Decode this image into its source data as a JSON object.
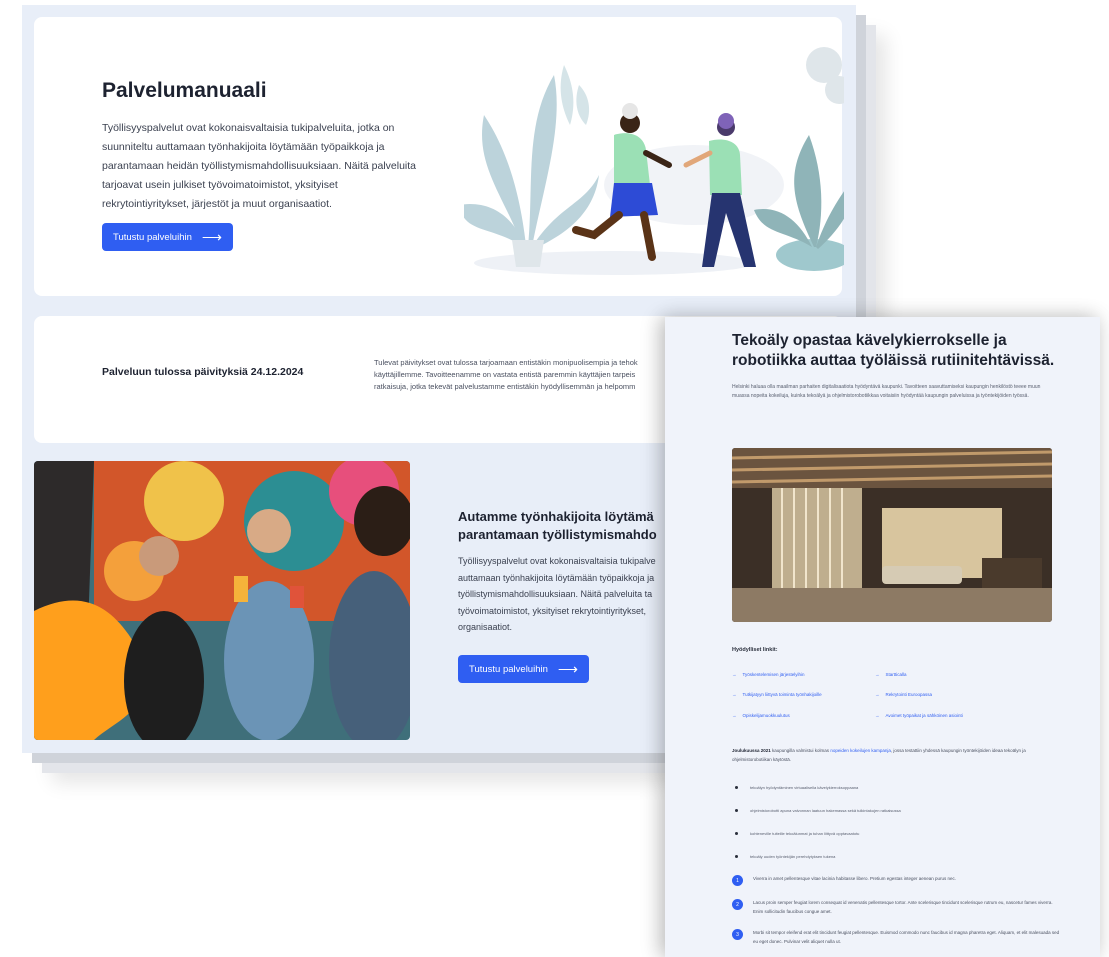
{
  "hero": {
    "title": "Palvelumanuaali",
    "lines": [
      "Työllisyyspalvelut ovat kokonaisvaltaisia tukipalveluita, jotka on",
      "suunniteltu auttamaan työnhakijoita löytämään työpaikkoja ja",
      "parantamaan heidän työllistymismahdollisuuksiaan. Näitä palveluita",
      "tarjoavat usein julkiset työvoimatoimistot, yksityiset",
      "rekrytointiyritykset, järjestöt ja muut organisaatiot."
    ],
    "button_label": "Tutustu palveluihin",
    "button_icon": "arrow-right-icon"
  },
  "update": {
    "title": "Palveluun tulossa päivityksiä 24.12.2024",
    "lines": [
      "Tulevat päivitykset ovat tulossa tarjoamaan entistäkin monipuolisempia ja tehok",
      "käyttäjillemme. Tavoitteenamme on vastata entistä paremmin käyttäjien tarpeis",
      "ratkaisuja, jotka tekevät palvelustamme entistäkin hyödyllisemmän ja helpomm"
    ]
  },
  "help": {
    "title_lines": [
      "Autamme työnhakijoita löytämä",
      "parantamaan työllistymismahdo"
    ],
    "lines": [
      "Työllisyyspalvelut ovat kokonaisvaltaisia tukipalve",
      "auttamaan työnhakijoita löytämään työpaikkoja ja",
      "työllistymismahdollisuuksiaan. Näitä palveluita ta",
      "työvoimatoimistot, yksityiset rekrytointiyritykset,",
      "organisaatiot."
    ],
    "button_label": "Tutustu palveluihin"
  },
  "article": {
    "title": "Tekoäly opastaa kävelykierrokselle ja robotiikka auttaa työläissä rutiinitehtävissä.",
    "intro": "Helsinki haluaa olla maailman parhaiten digitalisaatiota hyödyntävä kaupunki. Tavoitteen saavuttamiseksi kaupungin henkilöstö teeee muun muassa nopeita kokeiluja, kuinka tekoälyä ja ohjelmistorobotiikkaa voitaisiin hyödyntää kaupungin palveluissa ja työntekijöiden työssä.",
    "links_heading": "Hyödylliset linkit:",
    "links": [
      "Työskentelemisen järjestelyihin",
      "Startticalla",
      "Tutkijatyyn liittyvä toiminta työnhakijoille",
      "Rekrytointi Euroopassa",
      "Opiskelijamuokkuulutus",
      "Avoimet työpaikat ja sähköinen asiointi"
    ],
    "para_strong": "Joulukuussa 2021",
    "para_mid": " kaupungilla valmistui kolmas ",
    "para_link": "nopeiden kokeilujen kampanja",
    "para_end": ", jossa testattiin yhdessä kaupungin työntekijöiden ideaa tekoälyn ja ohjelmistorobotiikan käytöstä.",
    "bullets": [
      "tekoälyn hyödyntäminen virtuaalisella kävelykierroksoppaana",
      "ohjelmistorobotti apuna valvonnan laatuun hakemassa sekä tulkintakujen ratkaisussa",
      "kohteneville tuiteille tekoälunmat ja tuhan liittyvä opptavaatotu",
      "tekoäly uuden työntekijän perehdytyksen tukena"
    ],
    "numbered": [
      {
        "n": "1",
        "text": "Viverra in amet pellentesque vitae lacinia habitasse libero. Pretium egestas integer aenean purus nec."
      },
      {
        "n": "2",
        "text": "Lacus proin semper feugiat lorem consequat id venenatis pellentesque tortor. Ante scelerisque tincidunt scelerisque rutrum eu, nascetur fames viverra. Enim sollicitudin faucibus congue amet."
      },
      {
        "n": "3",
        "text": "Morbi sit tempor eleifend erat elit tincidunt feugiat pellentesque. Euismod commodo nunc faucibus id magna pharetra eget. Aliquam, et elit malesuada sed eu eget donec. Pulvinar velit aliquet nulla ut."
      }
    ]
  },
  "colors": {
    "accent": "#2f5ef2",
    "background": "#e8eef8",
    "card": "#ffffff"
  }
}
